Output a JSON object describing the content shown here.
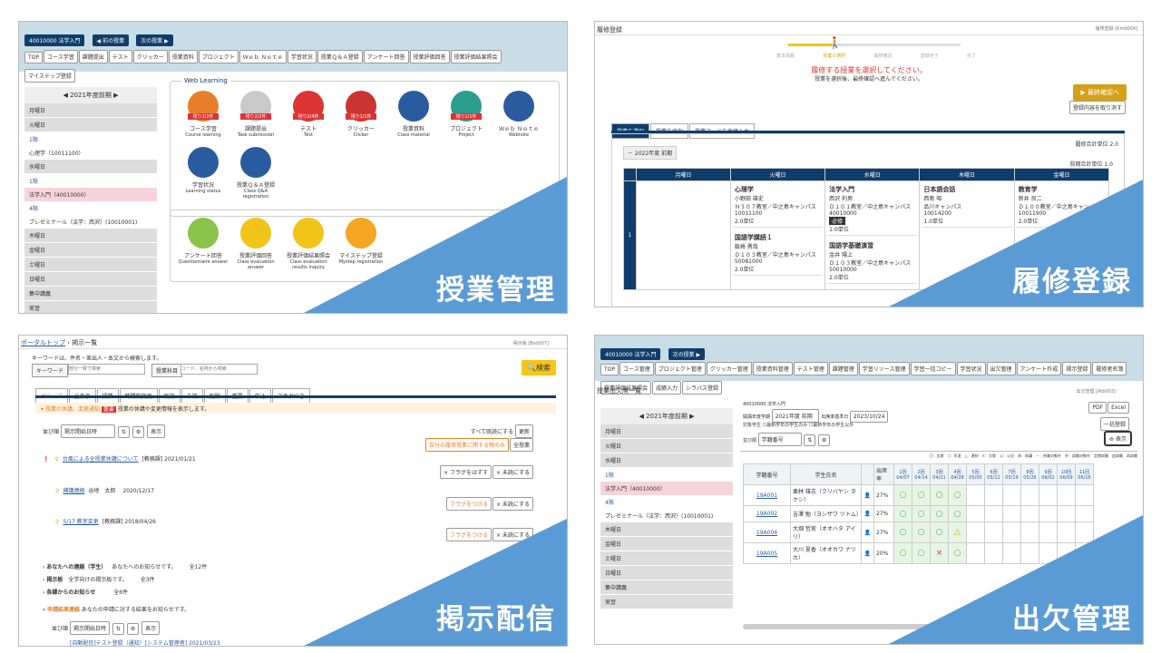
{
  "captions": {
    "p1": "授業管理",
    "p2": "履修登録",
    "p3": "掲示配信",
    "p4": "出欠管理"
  },
  "p1": {
    "course_btn": "40010000 法学入門",
    "prev": "◀ 前の授業",
    "next": "次の授業 ▶",
    "tabs": [
      "TOP",
      "コース学習",
      "課題提出",
      "テスト",
      "クリッカー",
      "授業資料",
      "プロジェクト",
      "Ｗｅｂ Ｎｏｔｅ",
      "学習状況",
      "授業Ｑ＆Ａ登録",
      "アンケート回答",
      "授業評価回答",
      "授業評価結果照会",
      "マイステップ登録"
    ],
    "term": "2021年度前期",
    "days": [
      "月曜日",
      "火曜日",
      "水曜日",
      "木曜日",
      "金曜日",
      "土曜日",
      "日曜日",
      "集中講義",
      "実習"
    ],
    "tue_period": "1限",
    "tue_course": "心理学（10011100）",
    "wed_period1": "1限",
    "wed_course1": "法学入門（40010000）",
    "wed_period2": "4限",
    "wed_course2": "プレゼミナール（法学：西沢）(10010001)",
    "weblearning": "Web Learning",
    "icons": [
      {
        "ja": "コース学習",
        "en": "Course learning",
        "badge": "残り2/2件",
        "color": "#e87e2a"
      },
      {
        "ja": "課題提出",
        "en": "Task submission",
        "badge": "残り2/2件",
        "color": "#c9c9c9"
      },
      {
        "ja": "テスト",
        "en": "Test",
        "badge": "残り2/4件",
        "color": "#d33"
      },
      {
        "ja": "クリッカー",
        "en": "Clicker",
        "badge": "残り1/1件",
        "color": "#c33"
      },
      {
        "ja": "授業資料",
        "en": "Class material",
        "badge": "",
        "color": "#2a5b9e"
      },
      {
        "ja": "プロジェクト",
        "en": "Project",
        "badge": "残り1/1件",
        "color": "#2a9d8f"
      },
      {
        "ja": "Ｗｅｂ Ｎｏｔｅ",
        "en": "Webnote",
        "badge": "",
        "color": "#2a5b9e"
      },
      {
        "ja": "学習状況",
        "en": "Learning status",
        "badge": "",
        "color": "#2a5b9e"
      },
      {
        "ja": "授業Ｑ＆Ａ登録",
        "en": "Class Q&A registration",
        "badge": "",
        "color": "#2a5b9e"
      }
    ],
    "icons2": [
      {
        "ja": "アンケート回答",
        "en": "Questionnaire answer",
        "color": "#8bc34a"
      },
      {
        "ja": "授業評価回答",
        "en": "Class evaluation answer",
        "color": "#f0c419"
      },
      {
        "ja": "授業評価結果照会",
        "en": "Class evaluation results inquiry",
        "color": "#f0c419"
      },
      {
        "ja": "マイステップ登録",
        "en": "Mystep registration",
        "color": "#f5a623"
      }
    ]
  },
  "p2": {
    "title": "履修登録",
    "code": "履修登録 [Kmd004]",
    "steps": [
      "基本情報",
      "授業の選択",
      "最終確認",
      "登録完了",
      "完了"
    ],
    "msg_red": "履修する授業を選択してください。",
    "msg": "授業を選択後、最終確認へ進んでください。",
    "confirm_btn": "最終確認へ",
    "cancel_btn": "登録内容を取り消す",
    "tabs": [
      "授業を選択",
      "授業を追加",
      "授業コードを直接入力"
    ],
    "total": "履修合計単位 2.0",
    "term": "2022年度 前期",
    "term_total": "前期合計単位 1.0",
    "week": [
      "月曜日",
      "火曜日",
      "水曜日",
      "木曜日",
      "金曜日"
    ],
    "period": "1",
    "tue": [
      [
        "心理学",
        "小野田 雄史",
        "Ｎ３０７教室／中之島キャンパス",
        "10011100",
        "2.0単位"
      ],
      [
        "国語学講読１",
        "飯崎 勇哉",
        "Ｄ１０３教室／中之島キャンパス",
        "50081000",
        "2.0単位"
      ]
    ],
    "wed": [
      [
        "法学入門",
        "西沢 利男",
        "Ｄ１０１教室／中之島キャンパス",
        "40010000",
        "必修",
        "1.0単位"
      ],
      [
        "国語学基礎演習",
        "金井 陽上",
        "Ｄ１０３教室／中之島キャンパス",
        "50010000",
        "2.0単位"
      ]
    ],
    "thu": [
      [
        "日本語会話",
        "西島 昭",
        "品川キャンパス",
        "10014200",
        "1.0単位"
      ]
    ],
    "fri": [
      [
        "教育学",
        "新井 良二",
        "Ｄ１００教室／中之島キャンパス",
        "10011900",
        "2.0単位"
      ]
    ]
  },
  "p3": {
    "crumb": "ポータルトップ",
    "crumb2": "掲示一覧",
    "code": "掲示板 [Bsd007]",
    "desc": "キーワードは、件名・差出人・本文から検索します。",
    "kw_label": "キーワード",
    "kw_ph": "部分一致で検索",
    "subj_label": "授業科目",
    "subj_ph": "コード、名称から検索",
    "search": "検索",
    "tabs": [
      "グループ",
      "全表示",
      "授業",
      "時間割変更",
      "既読",
      "未読",
      "削除",
      "重要",
      "申込",
      "フラグつき"
    ],
    "section": "授業の休講、変更通知",
    "section_badge": "重要",
    "section_desc": "授業の休講や変更情報を表示します。",
    "sort_label": "並び順",
    "sort_val": "掲示開始日時",
    "show": "表示",
    "readall": "すべて既読にする",
    "update": "更新",
    "own_only": "自分の履修授業に関する物のみ",
    "all": "全授業",
    "posts": [
      {
        "t": "台風による全授業休講について",
        "m": "[教務課] 2021/01/21",
        "b": "× フラグをはずす"
      },
      {
        "t": "補講連絡",
        "m": "谷地　太郎　 2020/12/17",
        "b": "フラグをつける"
      },
      {
        "t": "5/17 教室変更",
        "m": "[教務課] 2018/04/26",
        "b": "フラグをつける"
      }
    ],
    "unread": "× 未読にする",
    "groups": [
      {
        "name": "あなたへの連絡（学生）",
        "desc": "あなたへのお知らせです。",
        "n": "全12件"
      },
      {
        "name": "掲示板",
        "desc": "全学向けの掲示板です。",
        "n": "全3件"
      },
      {
        "name": "各課からのお知らせ",
        "desc": "",
        "n": "全6件"
      }
    ],
    "apply": "申請結果連絡",
    "apply_desc": "あなたの申請に対する結果をお知らせです。",
    "last": "[自動配信]テスト登録（通知）[システム管理者] 2021/03/23"
  },
  "p4": {
    "course_btn": "40010000 法学入門",
    "next": "次の授業 ▶",
    "tabs": [
      "TOP",
      "コース管理",
      "プロジェクト管理",
      "クリッカー管理",
      "授業資料管理",
      "テスト管理",
      "課題管理",
      "学習リソース管理",
      "学習一括コピー",
      "学習状況",
      "出欠管理",
      "アンケート作成",
      "掲示登録",
      "履修者名簿",
      "授業評価結果照会",
      "成績入力",
      "シラバス登録"
    ],
    "title": "授業出欠席一覧",
    "code": "出欠管理 [Atb003]",
    "term": "2021年度前期",
    "days": [
      "月曜日",
      "火曜日",
      "水曜日",
      "木曜日",
      "金曜日",
      "土曜日",
      "日曜日",
      "集中講義",
      "実習"
    ],
    "wed_period1": "1限",
    "wed_course1": "法学入門（40010000）",
    "wed_period2": "4限",
    "wed_course2": "プレゼミナール（法学：西沢）(10010001)",
    "course": "40010000 法学入門",
    "f_term_l": "開講年度学期",
    "f_term": "2021年度 前期",
    "f_base_l": "出席率基準日",
    "f_base": "2023/10/24",
    "f_target": "対象学生",
    "chk1": "最新学年の学生のみ",
    "chk2": "最新学年の学生以外",
    "f_sort": "並び順",
    "f_sort_v": "学籍番号",
    "pdf": "PDF",
    "excel": "Excel",
    "bulk": "一括登録",
    "show": "表示",
    "legend": "〇：出席　▽：早退　△：遅刻　×：欠席　公：公欠　休：休講　－：授業対象外　外：試験対象外　定期試験　追試験　再試験",
    "h_id": "学籍番号",
    "h_name": "学生氏名",
    "h_rate": "出席率",
    "dates": [
      "1回 04/07",
      "2回 04/14",
      "3回 04/21",
      "4回 04/28",
      "5回 05/05",
      "6回 05/12",
      "7回 05/19",
      "8回 05/26",
      "9回 06/02",
      "10回 06/09",
      "11回 06/16"
    ],
    "rows": [
      {
        "id": "19A001",
        "name": "栗林 雄志（クリバヤシ タケシ）",
        "rate": "27%",
        "m": [
          "○",
          "○",
          "○",
          "○"
        ]
      },
      {
        "id": "19A002",
        "name": "吉澤 勉（ヨシザワ ツトム）",
        "rate": "27%",
        "m": [
          "○",
          "○",
          "○",
          "○"
        ]
      },
      {
        "id": "19A004",
        "name": "大畑 哲実（オオハタ アイリ）",
        "rate": "27%",
        "m": [
          "○",
          "○",
          "○",
          "△"
        ]
      },
      {
        "id": "19A005",
        "name": "大川 夏香（オオカワ ナツカ）",
        "rate": "20%",
        "m": [
          "○",
          "○",
          "×",
          "○"
        ]
      }
    ]
  },
  "colors": {
    "accent": "#5b9bd5",
    "navy": "#0f3d6b",
    "bar": "#c9dde6"
  }
}
